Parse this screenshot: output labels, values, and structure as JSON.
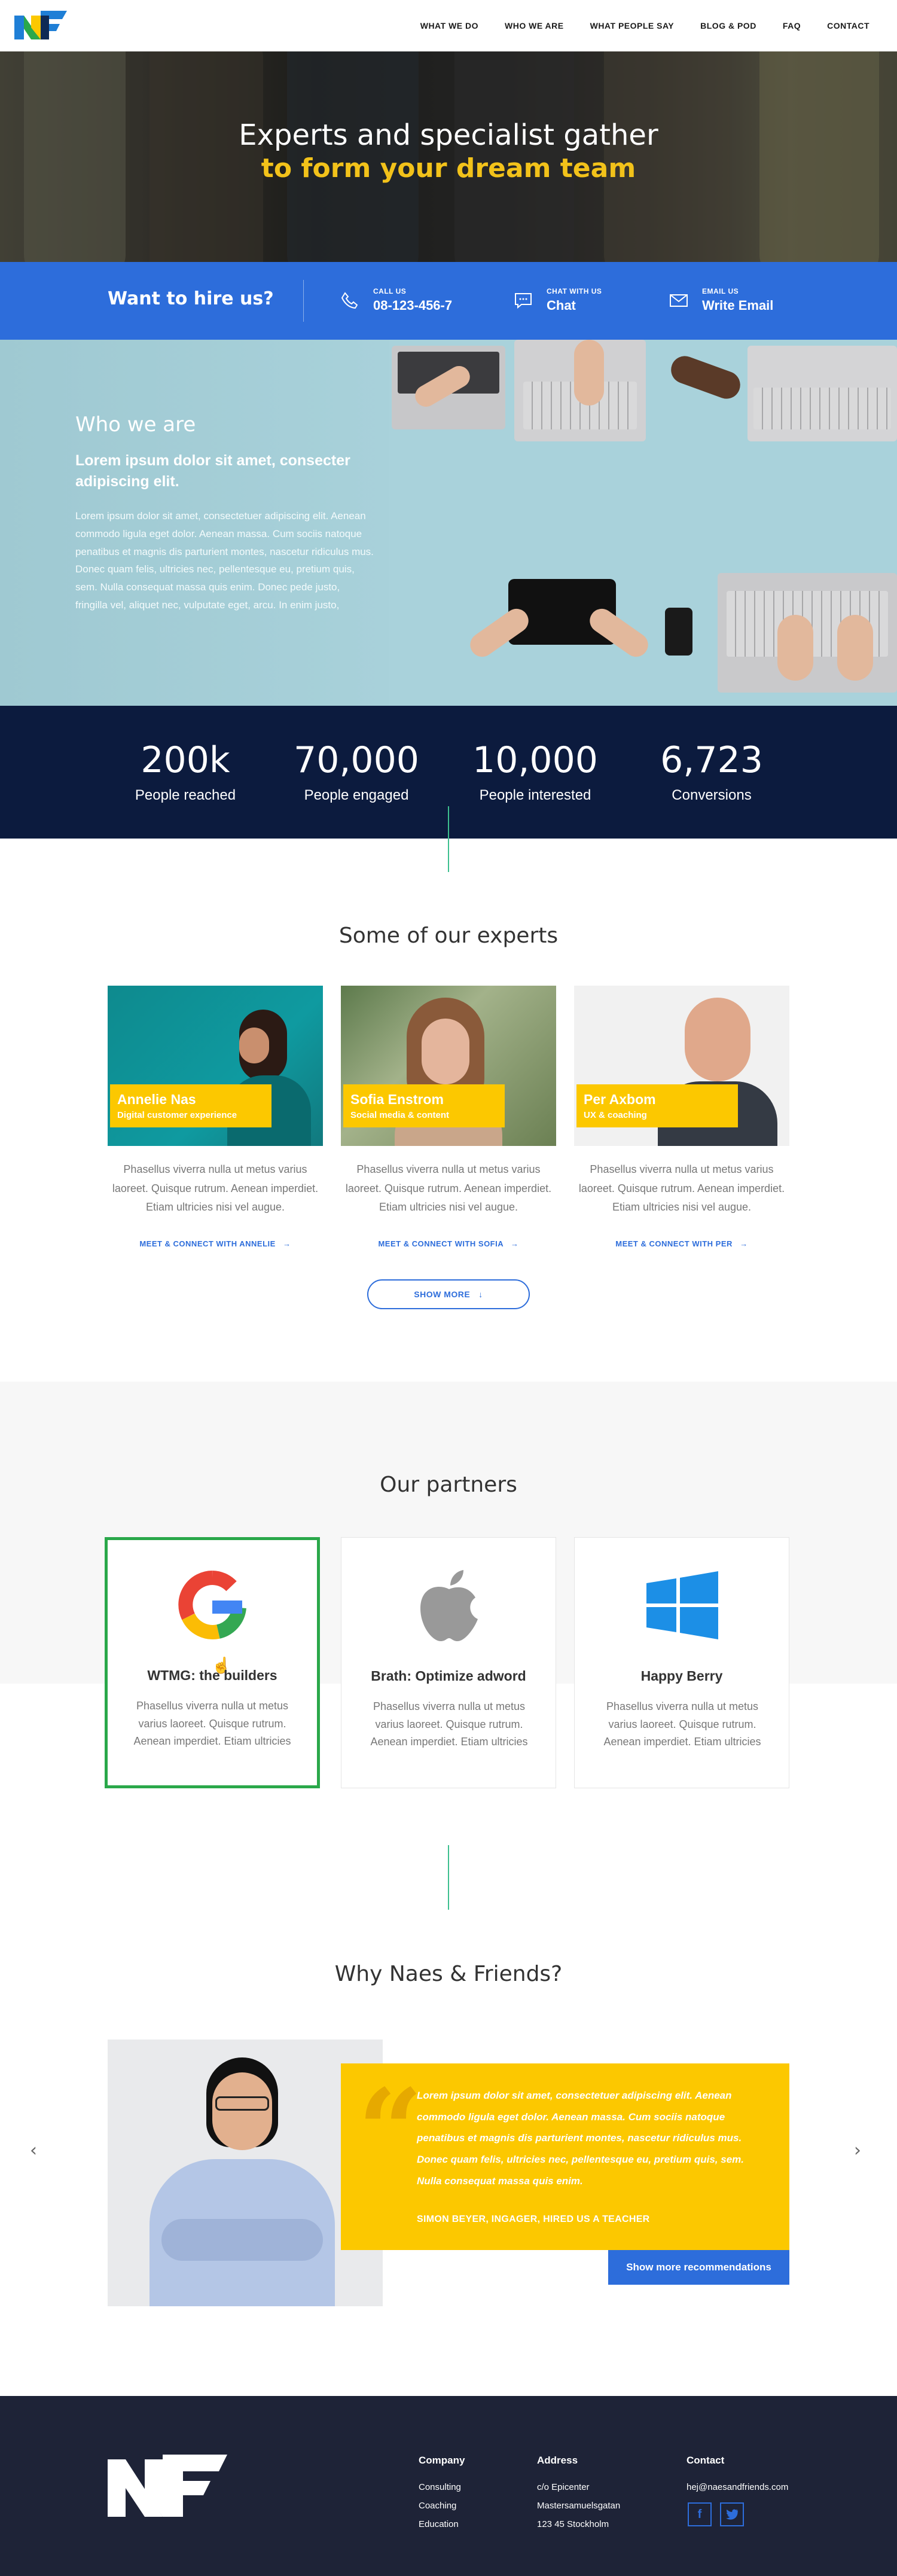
{
  "colors": {
    "brand_blue": "#2d6ddb",
    "brand_yellow": "#fcc800",
    "navy": "#0c1b3e",
    "footer": "#1e2337",
    "accent_green": "#3dbf8f"
  },
  "nav": {
    "logo_icon": "nf-logo-icon",
    "links": [
      "WHAT WE DO",
      "WHO WE ARE",
      "WHAT PEOPLE SAY",
      "BLOG & POD",
      "FAQ",
      "CONTACT"
    ]
  },
  "hero": {
    "title_line1": "Experts and specialist gather",
    "title_line2": "to form your dream team"
  },
  "hire": {
    "title": "Want to hire us?",
    "items": [
      {
        "label": "CALL US",
        "value": "08-123-456-7",
        "icon": "phone-icon"
      },
      {
        "label": "CHAT WITH US",
        "value": "Chat",
        "icon": "chat-icon"
      },
      {
        "label": "EMAIL US",
        "value": "Write Email",
        "icon": "mail-icon"
      }
    ]
  },
  "who": {
    "heading": "Who we are",
    "subheading": "Lorem ipsum dolor sit amet, consecter adipiscing elit.",
    "body": "Lorem ipsum dolor sit amet, consectetuer adipiscing elit. Aenean commodo ligula eget dolor. Aenean massa. Cum sociis natoque penatibus et magnis dis parturient montes, nascetur ridiculus mus. Donec quam felis, ultricies nec, pellentesque eu, pretium quis, sem. Nulla consequat massa quis enim. Donec pede justo, fringilla vel, aliquet nec, vulputate eget, arcu. In enim justo,"
  },
  "stats": [
    {
      "value": "200k",
      "label": "People reached"
    },
    {
      "value": "70,000",
      "label": "People engaged"
    },
    {
      "value": "10,000",
      "label": "People interested"
    },
    {
      "value": "6,723",
      "label": "Conversions"
    }
  ],
  "experts": {
    "heading": "Some of our experts",
    "items": [
      {
        "name": "Annelie Nas",
        "role": "Digital customer experience",
        "text": "Phasellus viverra nulla ut metus varius laoreet. Quisque rutrum. Aenean imperdiet. Etiam ultricies nisi vel augue.",
        "link": "MEET & CONNECT WITH ANNELIE"
      },
      {
        "name": "Sofia Enstrom",
        "role": "Social media & content",
        "text": "Phasellus viverra nulla ut metus varius laoreet. Quisque rutrum. Aenean imperdiet. Etiam ultricies nisi vel augue.",
        "link": "MEET & CONNECT WITH SOFIA"
      },
      {
        "name": "Per Axbom",
        "role": "UX & coaching",
        "text": "Phasellus viverra nulla ut metus varius laoreet. Quisque rutrum. Aenean imperdiet. Etiam ultricies nisi vel augue.",
        "link": "MEET & CONNECT WITH PER"
      }
    ],
    "show_more": "SHOW MORE"
  },
  "partners": {
    "heading": "Our partners",
    "items": [
      {
        "name": "WTMG: the builders",
        "text": "Phasellus viverra nulla ut metus varius laoreet. Quisque rutrum. Aenean imperdiet. Etiam ultricies",
        "logo": "google-logo-icon"
      },
      {
        "name": "Brath: Optimize adword",
        "text": "Phasellus viverra nulla ut metus varius laoreet. Quisque rutrum. Aenean imperdiet. Etiam ultricies",
        "logo": "apple-logo-icon"
      },
      {
        "name": "Happy Berry",
        "text": "Phasellus viverra nulla ut metus varius laoreet. Quisque rutrum. Aenean imperdiet. Etiam ultricies",
        "logo": "windows-logo-icon"
      }
    ]
  },
  "why": {
    "heading": "Why Naes & Friends?",
    "quote": "Lorem ipsum dolor sit amet, consectetuer adipiscing elit. Aenean commodo ligula eget dolor. Aenean massa. Cum sociis natoque penatibus et magnis dis parturient montes, nascetur ridiculus mus. Donec quam felis, ultricies nec, pellentesque eu, pretium quis, sem. Nulla consequat massa quis enim.",
    "author": "SIMON BEYER, INGAGER, HIRED US A TEACHER",
    "button": "Show more recommendations",
    "prev_icon": "chevron-left-icon",
    "next_icon": "chevron-right-icon"
  },
  "footer": {
    "company": {
      "heading": "Company",
      "links": [
        "Consulting",
        "Coaching",
        "Education"
      ]
    },
    "address": {
      "heading": "Address",
      "lines": [
        "c/o Epicenter",
        "Mastersamuelsgatan",
        "123 45 Stockholm"
      ]
    },
    "contact": {
      "heading": "Contact",
      "email": "hej@naesandfriends.com",
      "social": [
        "facebook-icon",
        "twitter-icon"
      ]
    }
  }
}
